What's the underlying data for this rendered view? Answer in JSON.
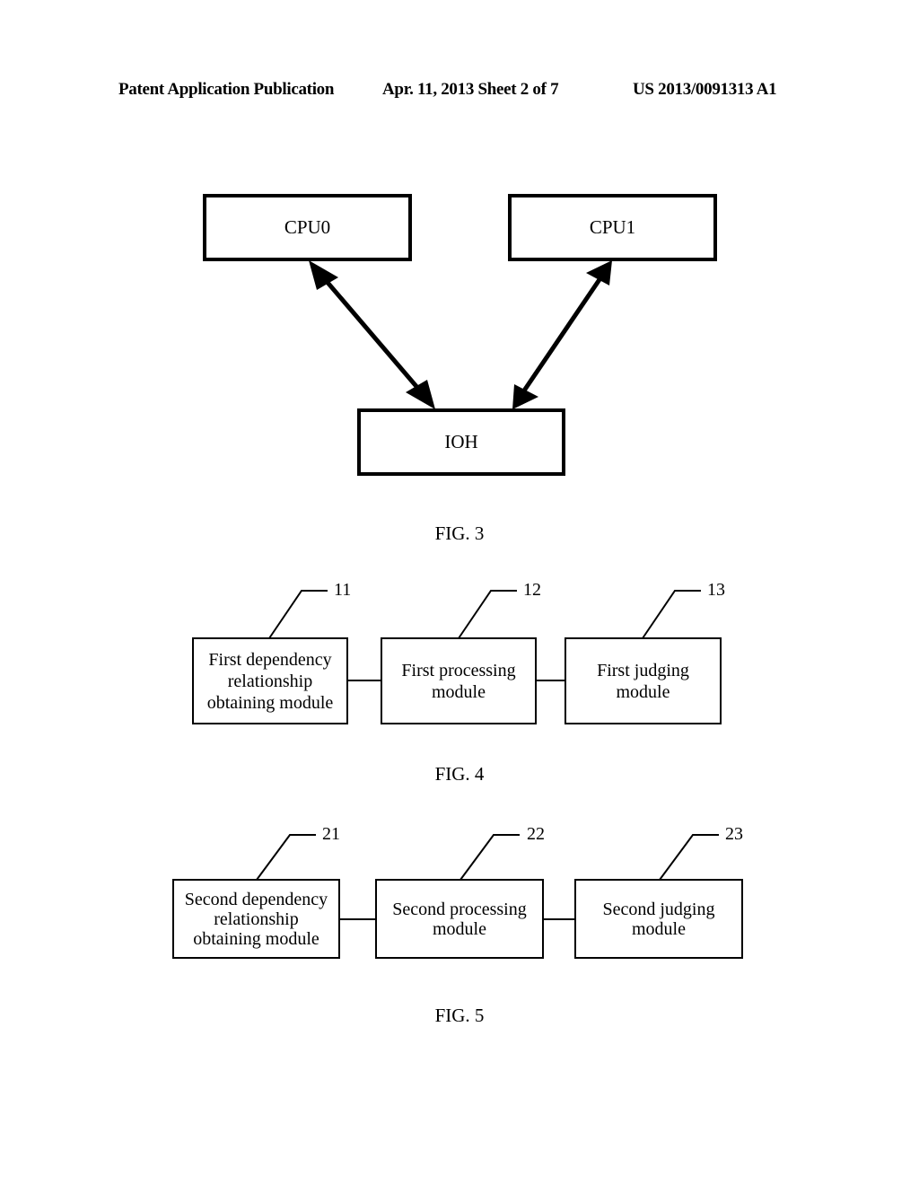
{
  "header": {
    "left": "Patent Application Publication",
    "middle": "Apr. 11, 2013  Sheet 2 of 7",
    "right": "US 2013/0091313 A1"
  },
  "fig3": {
    "caption": "FIG. 3",
    "nodes": {
      "cpu0": "CPU0",
      "cpu1": "CPU1",
      "ioh": "IOH"
    },
    "edges": [
      {
        "from": "cpu0",
        "to": "ioh",
        "type": "bidirectional"
      },
      {
        "from": "cpu1",
        "to": "ioh",
        "type": "bidirectional"
      }
    ]
  },
  "fig4": {
    "caption": "FIG. 4",
    "modules": [
      {
        "ref": "11",
        "label": "First dependency\nrelationship\nobtaining module"
      },
      {
        "ref": "12",
        "label": "First processing\nmodule"
      },
      {
        "ref": "13",
        "label": "First judging\nmodule"
      }
    ]
  },
  "fig5": {
    "caption": "FIG. 5",
    "modules": [
      {
        "ref": "21",
        "label": "Second dependency\nrelationship\nobtaining module"
      },
      {
        "ref": "22",
        "label": "Second processing\nmodule"
      },
      {
        "ref": "23",
        "label": "Second judging\nmodule"
      }
    ]
  }
}
